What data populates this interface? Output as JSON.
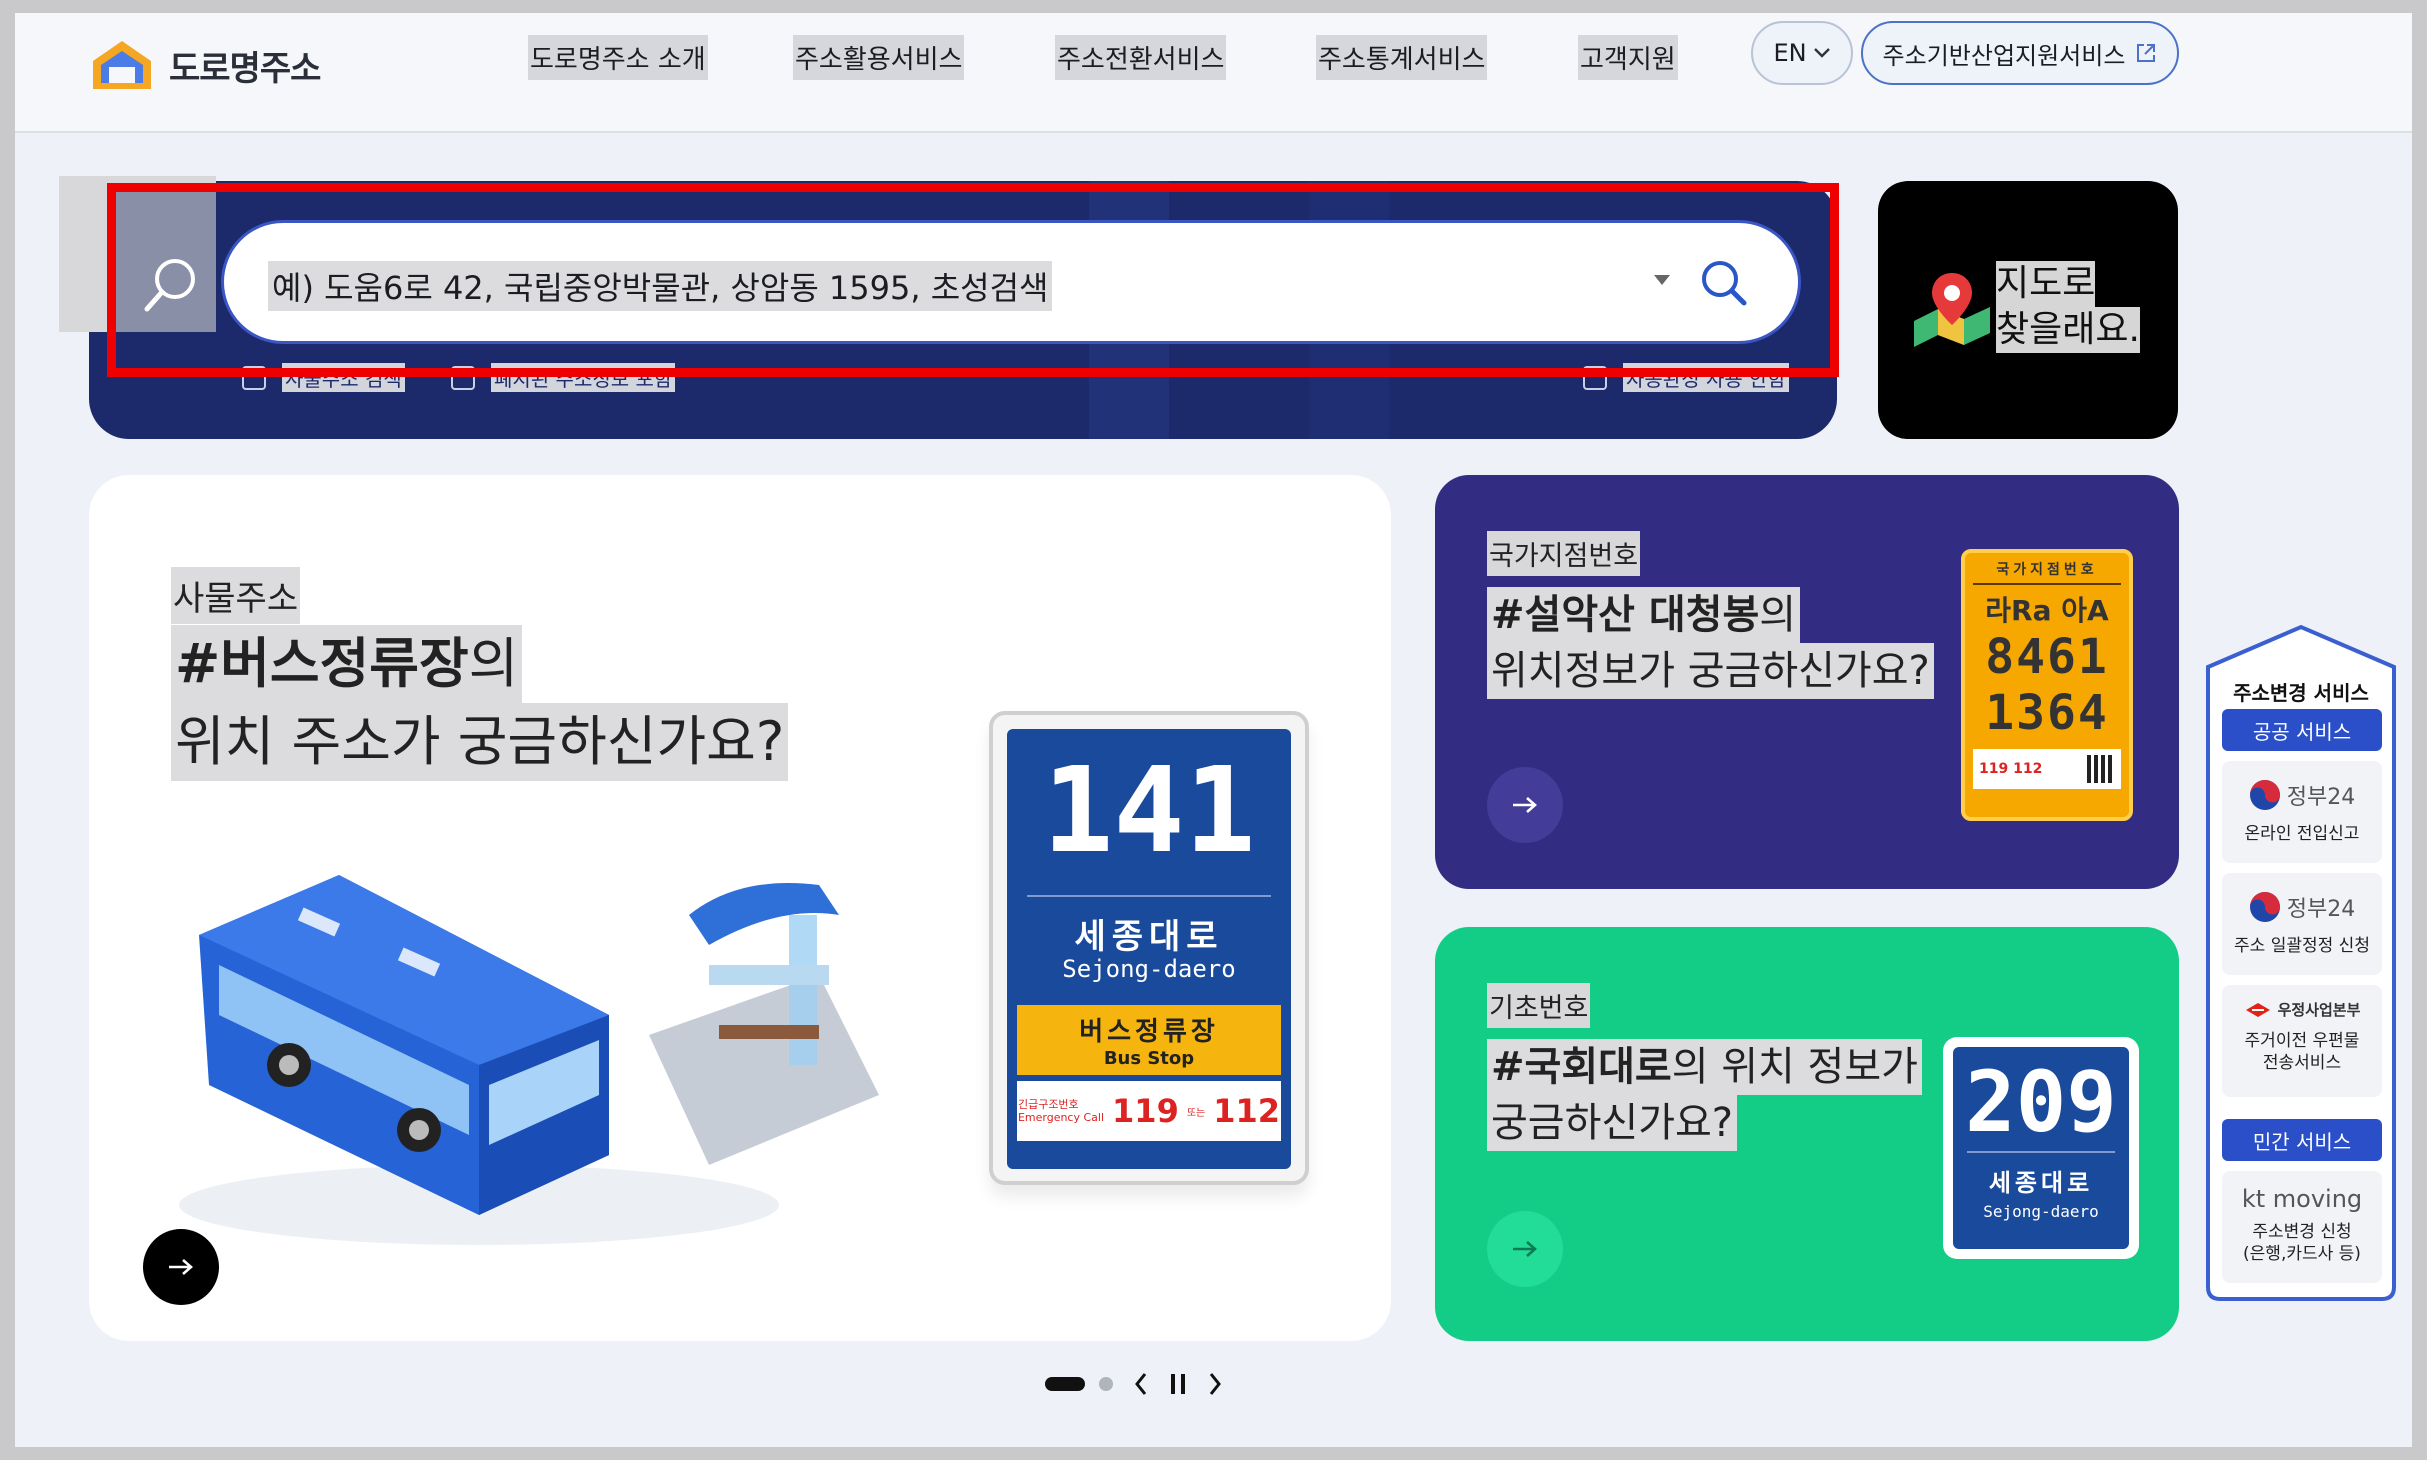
{
  "header": {
    "logo_text": "도로명주소",
    "nav": [
      "도로명주소 소개",
      "주소활용서비스",
      "주소전환서비스",
      "주소통계서비스",
      "고객지원"
    ],
    "lang_label": "EN",
    "biz_label": "주소기반산업지원서비스"
  },
  "search": {
    "placeholder": "예) 도움6로 42, 국립중앙박물관, 상암동 1595, 초성검색",
    "options": [
      "사물주소 검색",
      "폐지된 주소정보 포함",
      "자동완성 사용 안함"
    ]
  },
  "map_card": {
    "line1": "지도로",
    "line2": "찾을래요."
  },
  "main_card": {
    "tag": "사물주소",
    "headline_bold": "#버스정류장",
    "headline_rest": "의",
    "headline_line2": "위치 주소가 궁금하신가요?",
    "sign_number": "141",
    "sign_road_ko": "세종대로",
    "sign_road_en": "Sejong-daero",
    "sign_stop_ko": "버스정류장",
    "sign_stop_en": "Bus Stop",
    "sign_emergency_ko": "긴급구조번호",
    "sign_emergency_en": "Emergency Call",
    "sign_119": "119",
    "sign_or": "또는",
    "sign_112": "112"
  },
  "purple_card": {
    "tag": "국가지점번호",
    "headline_bold": "#설악산 대청봉",
    "headline_rest": "의",
    "headline_line2": "위치정보가 궁금하신가요?",
    "plate_title": "국가지점번호",
    "plate_letters": "라Ra 아A",
    "plate_num1": "8461",
    "plate_num2": "1364",
    "plate_footer": "119 112"
  },
  "green_card": {
    "tag": "기초번호",
    "headline_bold": "#국회대로",
    "headline_rest": "의 위치 정보가",
    "headline_line2": "궁금하신가요?",
    "sign_number": "209",
    "sign_road_ko": "세종대로",
    "sign_road_en": "Sejong-daero"
  },
  "side_panel": {
    "title": "주소변경 서비스",
    "public_label": "공공 서비스",
    "items": [
      {
        "brand": "정부24",
        "desc": "온라인 전입신고"
      },
      {
        "brand": "정부24",
        "desc": "주소 일괄정정 신청"
      },
      {
        "brand": "우정사업본부",
        "desc": "주거이전 우편물 전송서비스"
      }
    ],
    "private_label": "민간 서비스",
    "private_item": {
      "brand": "kt moving",
      "desc": "주소변경 신청 (은행,카드사 등)"
    }
  },
  "colors": {
    "navy": "#1c2a6b",
    "purple": "#322d82",
    "green": "#13cd86",
    "sign_blue": "#1a4a9c",
    "accent_blue": "#2a4fc8",
    "highlight_red": "#ee0000"
  }
}
